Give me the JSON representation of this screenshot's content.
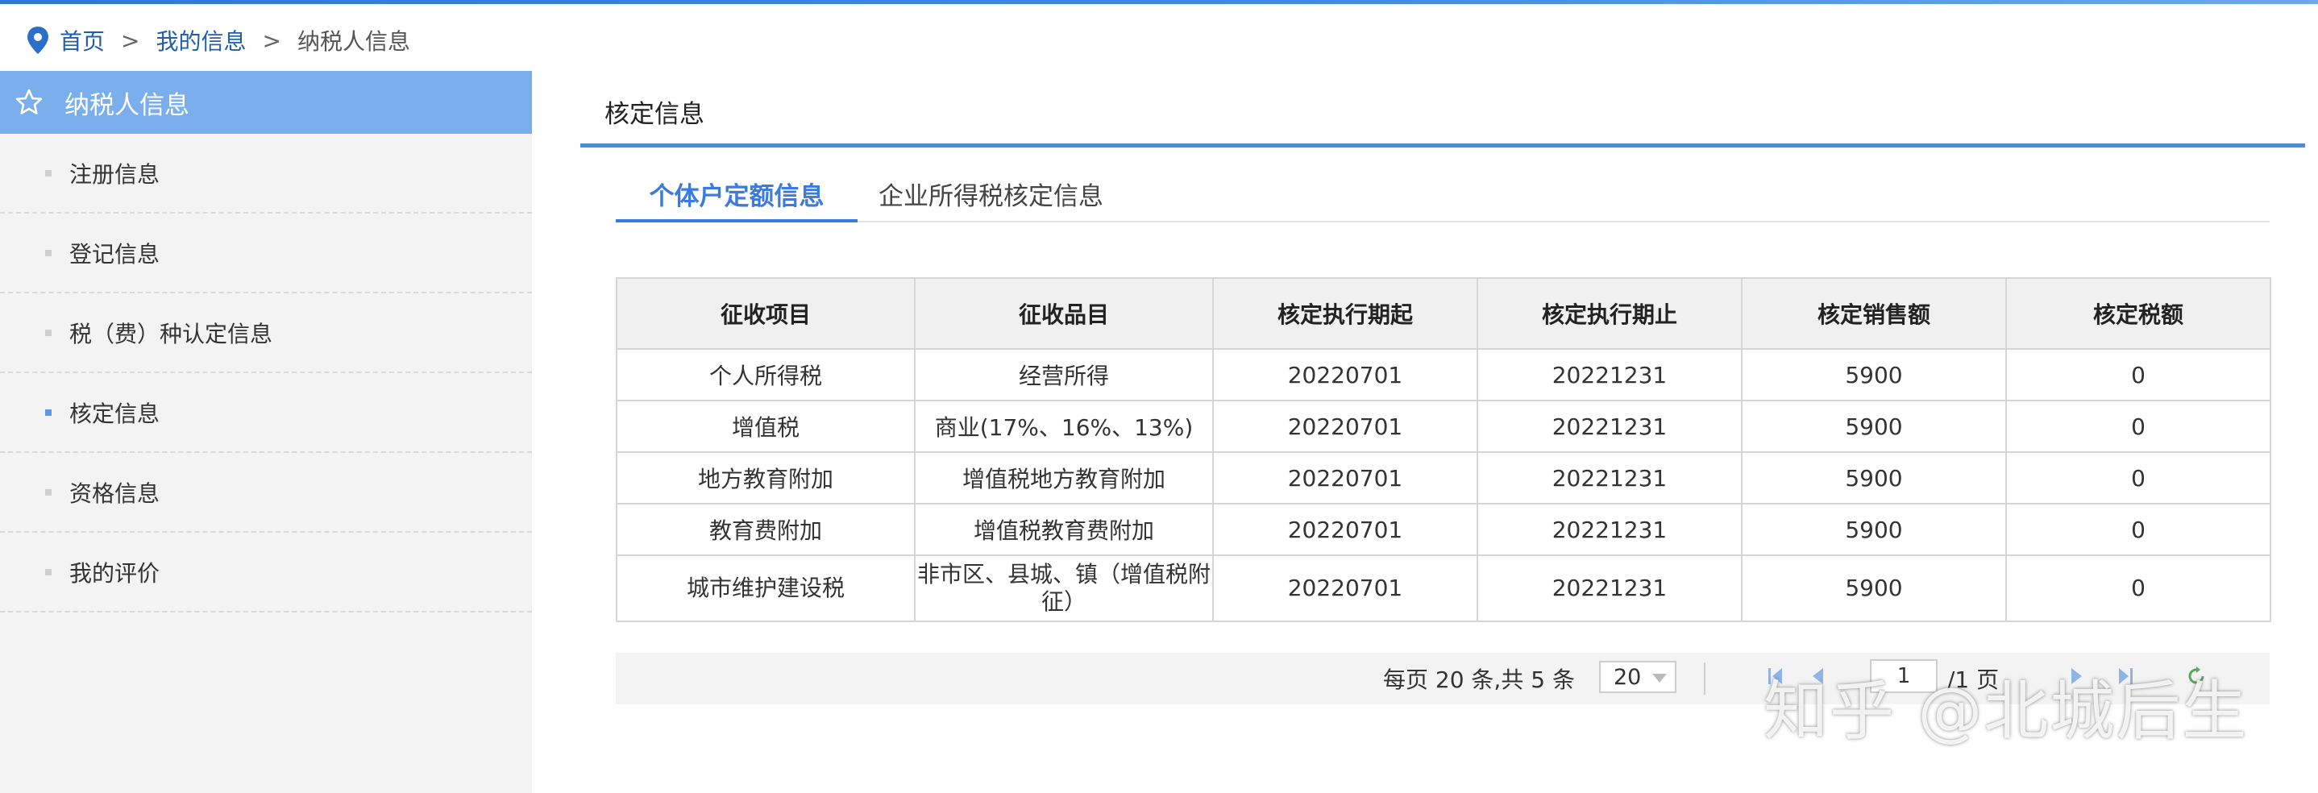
{
  "breadcrumb": {
    "home": "首页",
    "sep1": ">",
    "info": "我的信息",
    "sep2": ">",
    "current": "纳税人信息"
  },
  "sidebar": {
    "title": "纳税人信息",
    "items": [
      {
        "label": "注册信息",
        "active": false
      },
      {
        "label": "登记信息",
        "active": false
      },
      {
        "label": "税（费）种认定信息",
        "active": false
      },
      {
        "label": "核定信息",
        "active": true
      },
      {
        "label": "资格信息",
        "active": false
      },
      {
        "label": "我的评价",
        "active": false
      }
    ]
  },
  "main": {
    "section_title": "核定信息",
    "tabs": [
      {
        "label": "个体户定额信息",
        "active": true
      },
      {
        "label": "企业所得税核定信息",
        "active": false
      }
    ],
    "table": {
      "headers": [
        "征收项目",
        "征收品目",
        "核定执行期起",
        "核定执行期止",
        "核定销售额",
        "核定税额"
      ],
      "rows": [
        [
          "个人所得税",
          "经营所得",
          "20220701",
          "20221231",
          "5900",
          "0"
        ],
        [
          "增值税",
          "商业(17%、16%、13%)",
          "20220701",
          "20221231",
          "5900",
          "0"
        ],
        [
          "地方教育附加",
          "增值税地方教育附加",
          "20220701",
          "20221231",
          "5900",
          "0"
        ],
        [
          "教育费附加",
          "增值税教育费附加",
          "20220701",
          "20221231",
          "5900",
          "0"
        ],
        [
          "城市维护建设税",
          "非市区、县城、镇（增值税附征）",
          "20220701",
          "20221231",
          "5900",
          "0"
        ]
      ]
    },
    "pager": {
      "info": "每页 20 条,共 5 条",
      "page_size": "20",
      "current_page": "1",
      "total_pages": "/1 页"
    }
  },
  "watermark": "知乎 @北城后生",
  "colors": {
    "accent": "#3b7be0",
    "sidebar_header": "#7aaeed",
    "rule": "#4f8ad8",
    "link": "#1f5fa8"
  }
}
